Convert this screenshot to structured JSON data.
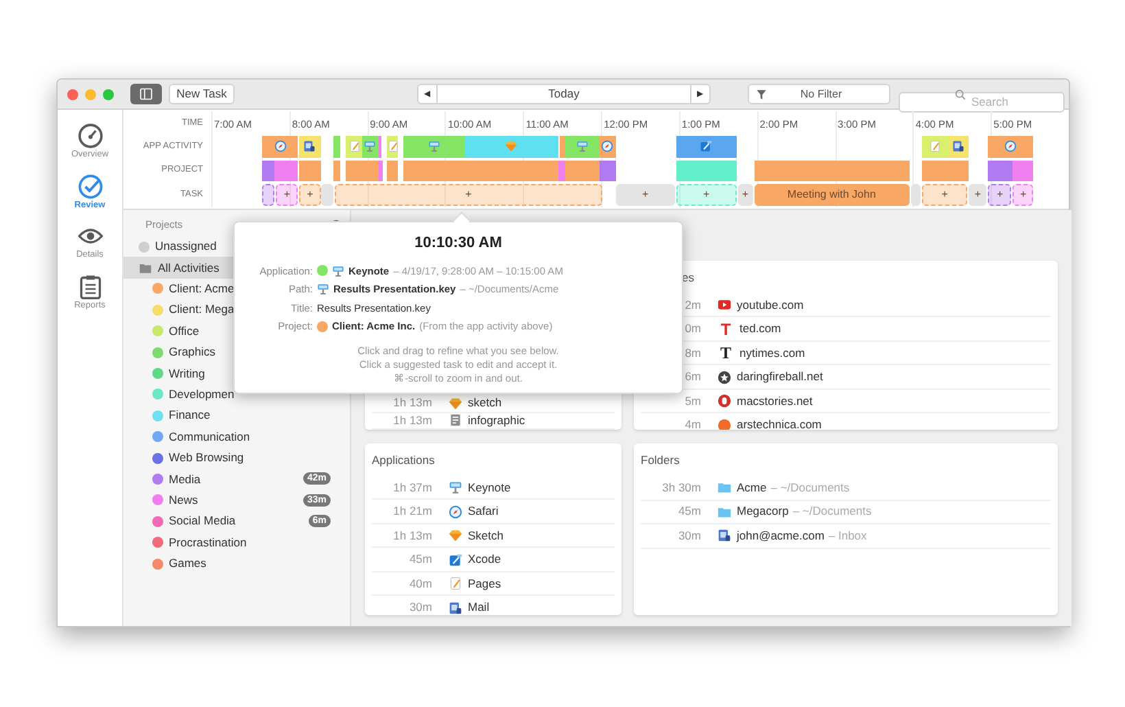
{
  "toolbar": {
    "sidebar_toggle": {
      "on": true
    },
    "new_task": "New Task",
    "prev": "◀",
    "date": "Today",
    "next": "▶",
    "filter": "No Filter",
    "search": {
      "placeholder": "Search"
    }
  },
  "nav": [
    {
      "label": "Overview",
      "kind": "gauge",
      "selected": false
    },
    {
      "label": "Review",
      "kind": "check",
      "selected": true
    },
    {
      "label": "Details",
      "kind": "eye",
      "selected": false
    },
    {
      "label": "Reports",
      "kind": "clipboard",
      "selected": false
    }
  ],
  "timeline": {
    "time_label": "TIME",
    "ticks": [
      "7:00 AM",
      "8:00 AM",
      "9:00 AM",
      "10:00 AM",
      "11:00 AM",
      "12:00 PM",
      "1:00 PM",
      "2:00 PM",
      "3:00 PM",
      "4:00 PM",
      "5:00 PM"
    ],
    "rows": [
      {
        "label": "APP ACTIVITY",
        "kind": "activity",
        "segments": [
          {
            "kind": "safari",
            "color": "#f8a765"
          },
          {
            "kind": "mail",
            "color": "#f6e36b"
          },
          {
            "kind": "bar",
            "color": "#84e464"
          },
          {
            "kind": "pages",
            "color": "#d9ef6e"
          },
          {
            "kind": "keynote",
            "color": "#84e464"
          },
          {
            "kind": "bar",
            "color": "#f07ff0"
          },
          {
            "kind": "pages",
            "color": "#d9ef6e"
          },
          {
            "kind": "keynote",
            "color": "#84e464"
          },
          {
            "kind": "sketch",
            "color": "#5fe0f0"
          },
          {
            "kind": "bar",
            "color": "#f8a765"
          },
          {
            "kind": "keynote",
            "color": "#84e464"
          },
          {
            "kind": "safari",
            "color": "#f8a765"
          },
          {
            "kind": "xcode",
            "color": "#5aa6ef"
          },
          {
            "kind": "pages",
            "color": "#d9ef6e"
          },
          {
            "kind": "mail",
            "color": "#f6e36b"
          },
          {
            "kind": "safari",
            "color": "#f8a765"
          }
        ]
      },
      {
        "label": "PROJECT",
        "kind": "project",
        "segments": [
          {
            "color": "#b07af0"
          },
          {
            "color": "#f07ff0"
          },
          {
            "color": "#f8a765"
          },
          {
            "color": "#f8a765"
          },
          {
            "color": "#f8a765"
          },
          {
            "color": "#f07ff0"
          },
          {
            "color": "#f8a765"
          },
          {
            "color": "#f8a765"
          },
          {
            "color": "#f07ff0"
          },
          {
            "color": "#f8a765"
          },
          {
            "color": "#b07af0"
          },
          {
            "color": "#62f0cc"
          },
          {
            "color": "#f8a765"
          },
          {
            "color": "#f8a765"
          },
          {
            "color": "#b07af0"
          },
          {
            "color": "#f07ff0"
          }
        ]
      },
      {
        "label": "TASK",
        "kind": "task",
        "segments": [
          {
            "kind": "suggested",
            "color": "#b07af0"
          },
          {
            "kind": "suggested",
            "color": "#f07ff0",
            "text": "+"
          },
          {
            "kind": "suggested",
            "color": "#f8a765",
            "text": "+"
          },
          {
            "kind": "empty"
          },
          {
            "kind": "suggested",
            "color": "#f8a765",
            "text": "+"
          },
          {
            "kind": "empty",
            "text": "+"
          },
          {
            "kind": "suggested",
            "color": "#62f0cc",
            "text": "+"
          },
          {
            "kind": "empty",
            "text": "+"
          },
          {
            "kind": "task",
            "color": "#f8a765",
            "text": "Meeting with John"
          },
          {
            "kind": "empty"
          },
          {
            "kind": "suggested",
            "color": "#f8a765",
            "text": "+"
          },
          {
            "kind": "empty",
            "text": "+"
          },
          {
            "kind": "suggested",
            "color": "#b07af0",
            "text": "+"
          },
          {
            "kind": "suggested",
            "color": "#f07ff0",
            "text": "+"
          }
        ]
      }
    ]
  },
  "sidebar": {
    "title": "Projects",
    "items": [
      {
        "label": "Unassigned",
        "color": "#cfcfcf",
        "selected": false
      },
      {
        "label": "All Activities",
        "kind": "folder",
        "selected": true,
        "children": [
          {
            "label": "Client: Acme",
            "color": "#f8a765",
            "selected": false
          },
          {
            "label": "Client: Mega",
            "color": "#f6dc6b",
            "selected": false
          },
          {
            "label": "Office",
            "color": "#c8e86a",
            "selected": false
          },
          {
            "label": "Graphics",
            "color": "#80d870",
            "selected": false
          },
          {
            "label": "Writing",
            "color": "#5ed98a",
            "selected": false
          },
          {
            "label": "Developmen",
            "color": "#6be6c8",
            "selected": false
          },
          {
            "label": "Finance",
            "color": "#6fe0f0",
            "selected": false
          },
          {
            "label": "Communication",
            "color": "#70a8f5",
            "selected": false
          },
          {
            "label": "Web Browsing",
            "color": "#6a70e6",
            "selected": false
          },
          {
            "label": "Media",
            "color": "#b07af0",
            "selected": false,
            "badge": "42m"
          },
          {
            "label": "News",
            "color": "#ee7ef0",
            "selected": false,
            "badge": "33m"
          },
          {
            "label": "Social Media",
            "color": "#f06ab8",
            "selected": false,
            "badge": "6m"
          },
          {
            "label": "Procrastination",
            "color": "#f06a7a",
            "selected": false
          },
          {
            "label": "Games",
            "color": "#f5896a",
            "selected": false
          }
        ]
      }
    ]
  },
  "cards": [
    {
      "rows": [
        {
          "time": "1h 13m",
          "kind": "sketch",
          "name": "sketch"
        },
        {
          "time": "1h 13m",
          "kind": "document",
          "name": "infographic"
        }
      ]
    },
    {
      "title": "es",
      "rows": [
        {
          "time": "2m",
          "kind": "youtube",
          "name": "youtube.com"
        },
        {
          "time": "0m",
          "kind": "letter",
          "glyph": "T",
          "name": "ted.com"
        },
        {
          "time": "8m",
          "kind": "serif",
          "glyph": "T",
          "name": "nytimes.com"
        },
        {
          "time": "6m",
          "kind": "star",
          "name": "daringfireball.net"
        },
        {
          "time": "5m",
          "kind": "ring",
          "name": "macstories.net"
        },
        {
          "time": "4m",
          "kind": "dot",
          "name": "arstechnica.com"
        }
      ]
    },
    {
      "title": "Applications",
      "rows": [
        {
          "time": "1h 37m",
          "kind": "keynote",
          "name": "Keynote"
        },
        {
          "time": "1h 21m",
          "kind": "safari",
          "name": "Safari"
        },
        {
          "time": "1h 13m",
          "kind": "sketch",
          "name": "Sketch"
        },
        {
          "time": "45m",
          "kind": "xcode",
          "name": "Xcode"
        },
        {
          "time": "40m",
          "kind": "pages",
          "name": "Pages"
        },
        {
          "time": "30m",
          "kind": "mail",
          "name": "Mail"
        }
      ]
    },
    {
      "title": "Folders",
      "rows": [
        {
          "time": "3h 30m",
          "kind": "folder",
          "name": "Acme",
          "detail": "– ~/Documents"
        },
        {
          "time": "45m",
          "kind": "folder",
          "name": "Megacorp",
          "detail": "– ~/Documents"
        },
        {
          "time": "30m",
          "kind": "mail",
          "name": "john@acme.com",
          "detail": "– Inbox"
        }
      ]
    }
  ],
  "tooltip": {
    "title": "10:10:30 AM",
    "rows": [
      {
        "label": "Application:",
        "color": "#84e464",
        "kind": "keynote",
        "value": "Keynote",
        "detail": "– 4/19/17, 9:28:00 AM – 10:15:00 AM"
      },
      {
        "label": "Path:",
        "kind": "keynote",
        "value": "Results Presentation.key",
        "detail": "– ~/Documents/Acme"
      },
      {
        "label": "Title:",
        "value": "Results Presentation.key"
      },
      {
        "label": "Project:",
        "color": "#f8a765",
        "value": "Client: Acme Inc.",
        "detail": "(From the app activity above)"
      }
    ],
    "hints": [
      "Click and drag to refine what you see below.",
      "Click a suggested task to edit and accept it.",
      "⌘-scroll to zoom in and out."
    ]
  }
}
